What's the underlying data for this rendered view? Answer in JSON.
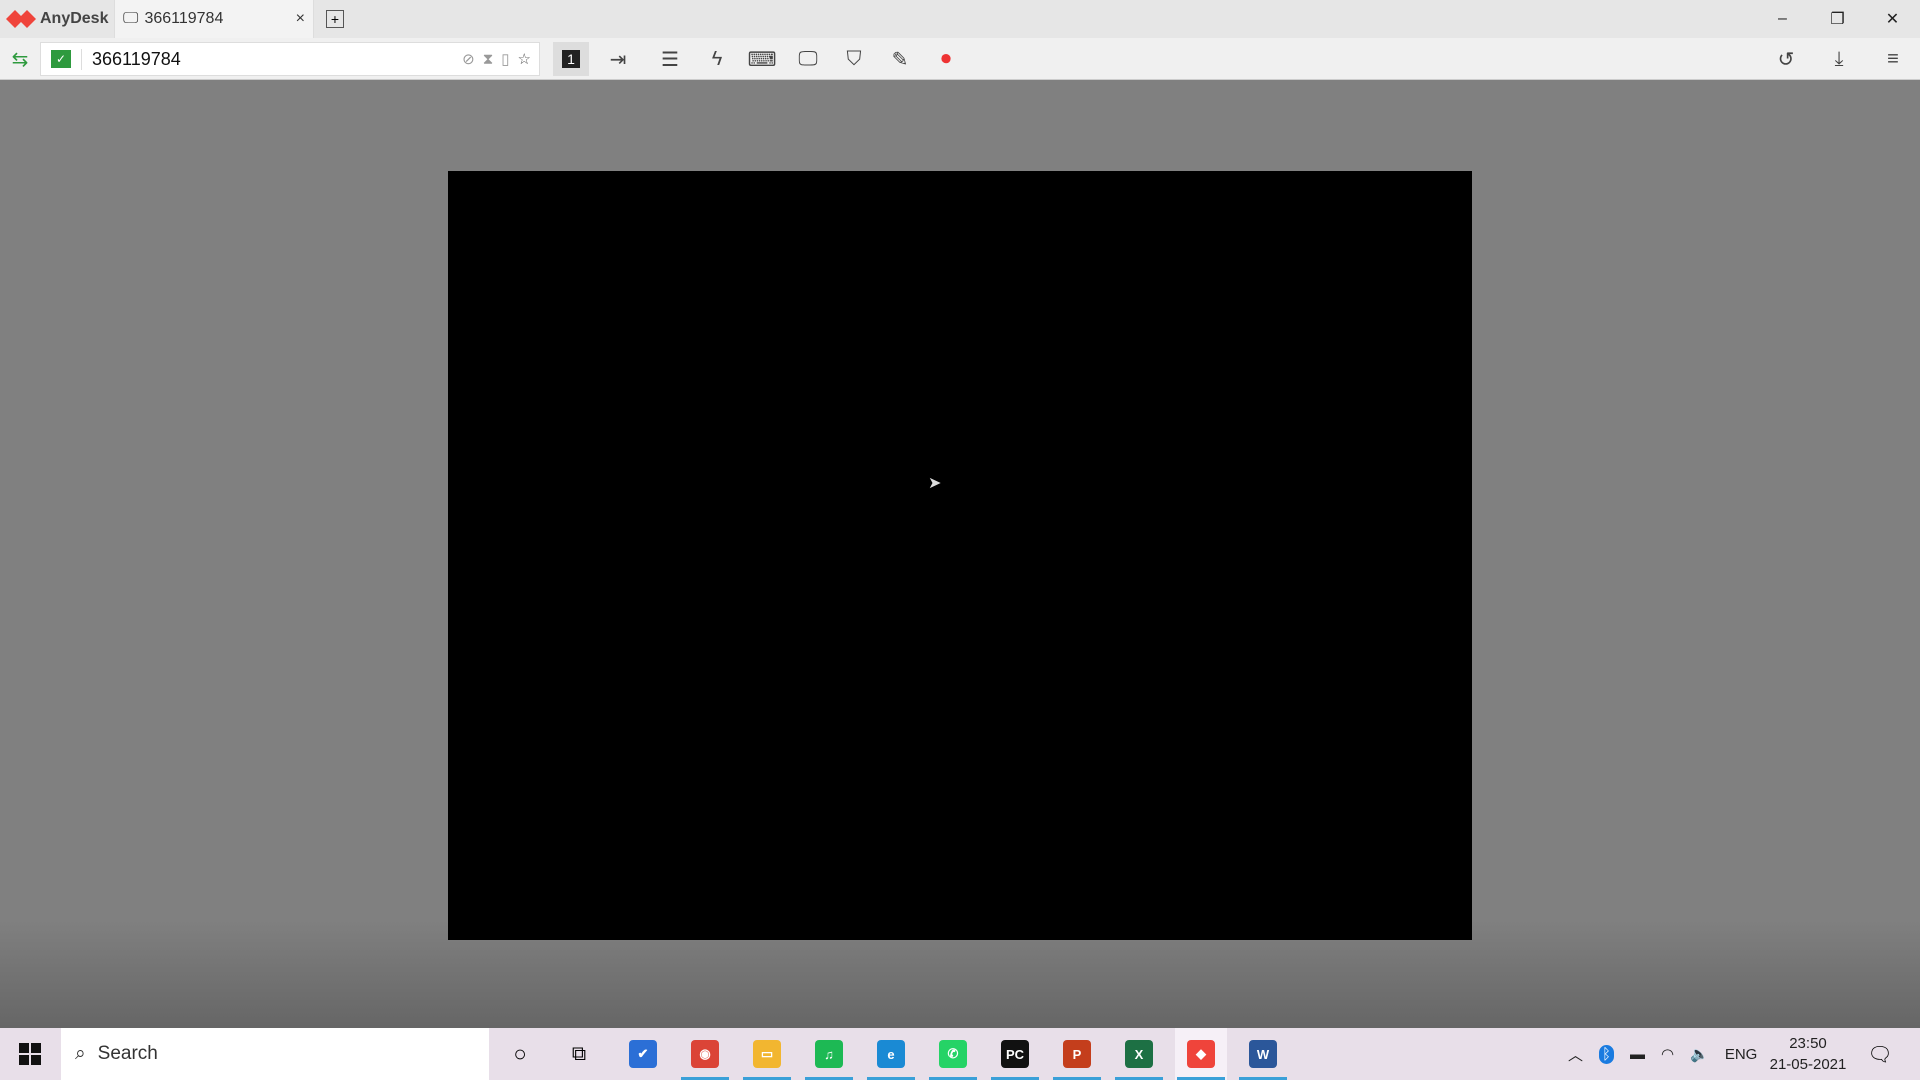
{
  "app": {
    "name": "AnyDesk",
    "brand_color": "#ef443b"
  },
  "tab": {
    "label": "366119784",
    "close": "×",
    "new_tab": "+"
  },
  "window_controls": {
    "minimize": "–",
    "restore": "❐",
    "close": "✕"
  },
  "toolbar": {
    "address_value": "366119784",
    "monitor_number": "1",
    "icons": [
      "file-transfer-icon",
      "chat-icon",
      "actions-icon",
      "keyboard-icon",
      "display-icon",
      "permissions-icon",
      "whiteboard-icon",
      "record-icon"
    ],
    "right_icons": [
      "history-icon",
      "download-icon",
      "menu-icon"
    ]
  },
  "taskbar": {
    "search_placeholder": "Search",
    "apps": [
      {
        "name": "todo",
        "label": "✔",
        "color": "#2b6fd6"
      },
      {
        "name": "chrome",
        "label": "◉",
        "color": "#db4437"
      },
      {
        "name": "file-explorer",
        "label": "▭",
        "color": "#f2b630"
      },
      {
        "name": "spotify",
        "label": "♫",
        "color": "#1db954"
      },
      {
        "name": "edge",
        "label": "e",
        "color": "#1a8ad4"
      },
      {
        "name": "whatsapp",
        "label": "✆",
        "color": "#25d366"
      },
      {
        "name": "pycharm",
        "label": "PC",
        "color": "#111111"
      },
      {
        "name": "powerpoint",
        "label": "P",
        "color": "#c43e1c"
      },
      {
        "name": "excel",
        "label": "X",
        "color": "#1d7044"
      },
      {
        "name": "anydesk",
        "label": "◆",
        "color": "#ef443b"
      },
      {
        "name": "word",
        "label": "W",
        "color": "#2b579a"
      }
    ],
    "tray": {
      "language": "ENG",
      "time": "23:50",
      "date": "21-05-2021"
    }
  }
}
